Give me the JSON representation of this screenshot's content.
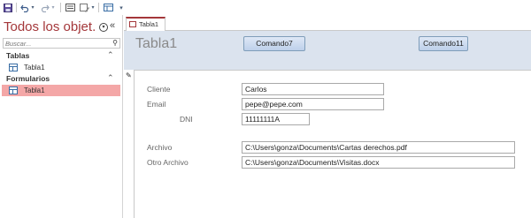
{
  "quick_access": {
    "icons": [
      "save-icon",
      "undo-icon",
      "undo-dropdown-icon",
      "redo-icon",
      "redo-dropdown-icon",
      "form-view-icon",
      "mode-icon",
      "table-icon",
      "customize-icon"
    ]
  },
  "nav": {
    "title": "Todos los objet...",
    "menu_glyph": "▾",
    "collapse_glyph": "«",
    "search_placeholder": "Buscar...",
    "search_glyph": "⚲",
    "groups": [
      {
        "label": "Tablas",
        "chevron": "⌃",
        "items": [
          {
            "label": "Tabla1",
            "selected": false
          }
        ]
      },
      {
        "label": "Formularios",
        "chevron": "⌃",
        "items": [
          {
            "label": "Tabla1",
            "selected": true
          }
        ]
      }
    ]
  },
  "doc_tab": {
    "label": "Tabla1"
  },
  "form": {
    "title": "Tabla1",
    "buttons": [
      {
        "label": "Comando7"
      },
      {
        "label": "Comando11"
      }
    ],
    "pencil_glyph": "✎",
    "fields": {
      "cliente": {
        "label": "Cliente",
        "value": "Carlos"
      },
      "email": {
        "label": "Email",
        "value": "pepe@pepe.com"
      },
      "dni": {
        "label": "DNI",
        "value": "11111111A"
      },
      "archivo": {
        "label": "Archivo",
        "value": "C:\\Users\\gonza\\Documents\\Cartas derechos.pdf"
      },
      "otro_archivo": {
        "label": "Otro Archivo",
        "value": "C:\\Users\\gonza\\Documents\\Visitas.docx"
      }
    }
  },
  "colors": {
    "accent": "#a4373a",
    "header_bg": "#dbe3ee",
    "selected_item": "#f4a7a7"
  }
}
